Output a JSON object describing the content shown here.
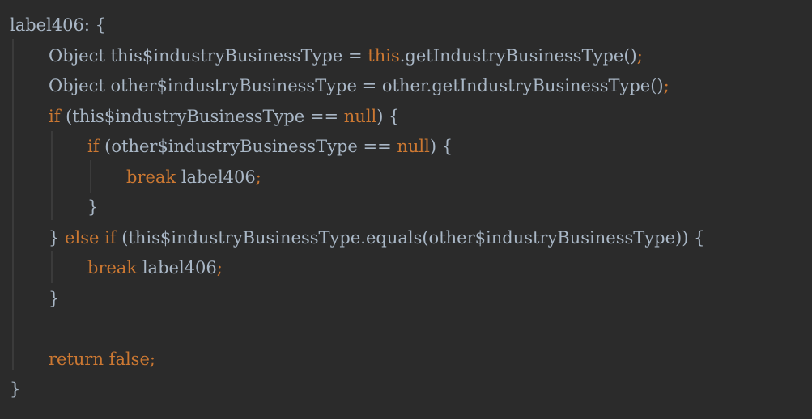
{
  "editor": {
    "lines": [
      {
        "tokens": [
          {
            "t": "label406: {",
            "k": "id"
          }
        ]
      },
      {
        "tokens": [
          {
            "t": "Object this$industryBusinessType = ",
            "k": "id"
          },
          {
            "t": "this",
            "k": "kw"
          },
          {
            "t": ".getIndustryBusinessType()",
            "k": "id"
          },
          {
            "t": ";",
            "k": "semi"
          }
        ]
      },
      {
        "tokens": [
          {
            "t": "Object other$industryBusinessType = other.getIndustryBusinessType()",
            "k": "id"
          },
          {
            "t": ";",
            "k": "semi"
          }
        ]
      },
      {
        "tokens": [
          {
            "t": "if",
            "k": "kw"
          },
          {
            "t": " (this$industryBusinessType == ",
            "k": "id"
          },
          {
            "t": "null",
            "k": "kw"
          },
          {
            "t": ") {",
            "k": "id"
          }
        ]
      },
      {
        "tokens": [
          {
            "t": "if",
            "k": "kw"
          },
          {
            "t": " (other$industryBusinessType == ",
            "k": "id"
          },
          {
            "t": "null",
            "k": "kw"
          },
          {
            "t": ") {",
            "k": "id"
          }
        ]
      },
      {
        "tokens": [
          {
            "t": "break",
            "k": "kw"
          },
          {
            "t": " label406",
            "k": "id"
          },
          {
            "t": ";",
            "k": "semi"
          }
        ]
      },
      {
        "tokens": [
          {
            "t": "}",
            "k": "id"
          }
        ]
      },
      {
        "tokens": [
          {
            "t": "} ",
            "k": "id"
          },
          {
            "t": "else if",
            "k": "kw"
          },
          {
            "t": " (this$industryBusinessType.equals(other$industryBusinessType)) {",
            "k": "id"
          }
        ]
      },
      {
        "tokens": [
          {
            "t": "break",
            "k": "kw"
          },
          {
            "t": " label406",
            "k": "id"
          },
          {
            "t": ";",
            "k": "semi"
          }
        ]
      },
      {
        "tokens": [
          {
            "t": "}",
            "k": "id"
          }
        ]
      },
      {
        "tokens": []
      },
      {
        "tokens": [
          {
            "t": "return false",
            "k": "kw"
          },
          {
            "t": ";",
            "k": "semi"
          }
        ]
      },
      {
        "tokens": [
          {
            "t": "}",
            "k": "id"
          }
        ]
      }
    ]
  },
  "colors": {
    "background": "#2b2b2b",
    "keyword": "#cc7832",
    "identifier": "#a9b7c6",
    "indent_guide": "#3b3b3b"
  }
}
